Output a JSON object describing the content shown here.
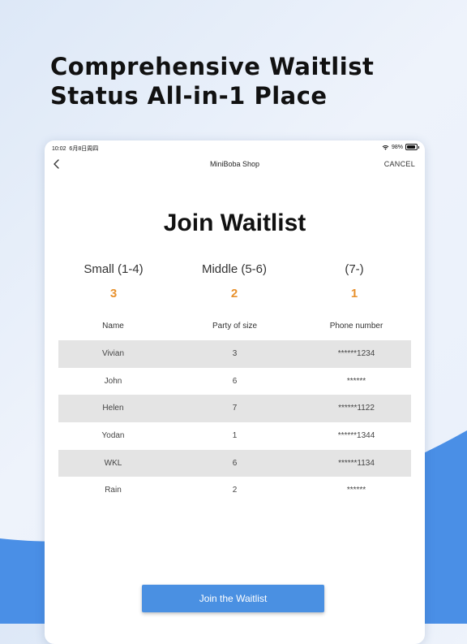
{
  "promo": {
    "headline_line1": "Comprehensive Waitlist",
    "headline_line2": "Status All-in-1 Place"
  },
  "status_bar": {
    "time": "10:02",
    "date": "6月8日周四",
    "battery": "98%"
  },
  "nav": {
    "title": "MiniBoba Shop",
    "cancel_label": "CANCEL"
  },
  "page": {
    "title": "Join Waitlist"
  },
  "counts": [
    {
      "label": "Small (1-4)",
      "value": "3"
    },
    {
      "label": "Middle (5-6)",
      "value": "2"
    },
    {
      "label": "(7-)",
      "value": "1"
    }
  ],
  "table": {
    "headers": [
      "Name",
      "Party of size",
      "Phone number"
    ],
    "rows": [
      {
        "name": "Vivian",
        "size": "3",
        "phone": "******1234"
      },
      {
        "name": "John",
        "size": "6",
        "phone": "******"
      },
      {
        "name": "Helen",
        "size": "7",
        "phone": "******1122"
      },
      {
        "name": "Yodan",
        "size": "1",
        "phone": "******1344"
      },
      {
        "name": "WKL",
        "size": "6",
        "phone": "******1134"
      },
      {
        "name": "Rain",
        "size": "2",
        "phone": "******"
      }
    ]
  },
  "actions": {
    "join_label": "Join the Waitlist"
  },
  "colors": {
    "accent_blue": "#4a90e2",
    "count_orange": "#e8912d",
    "row_shade": "#e4e4e4"
  }
}
